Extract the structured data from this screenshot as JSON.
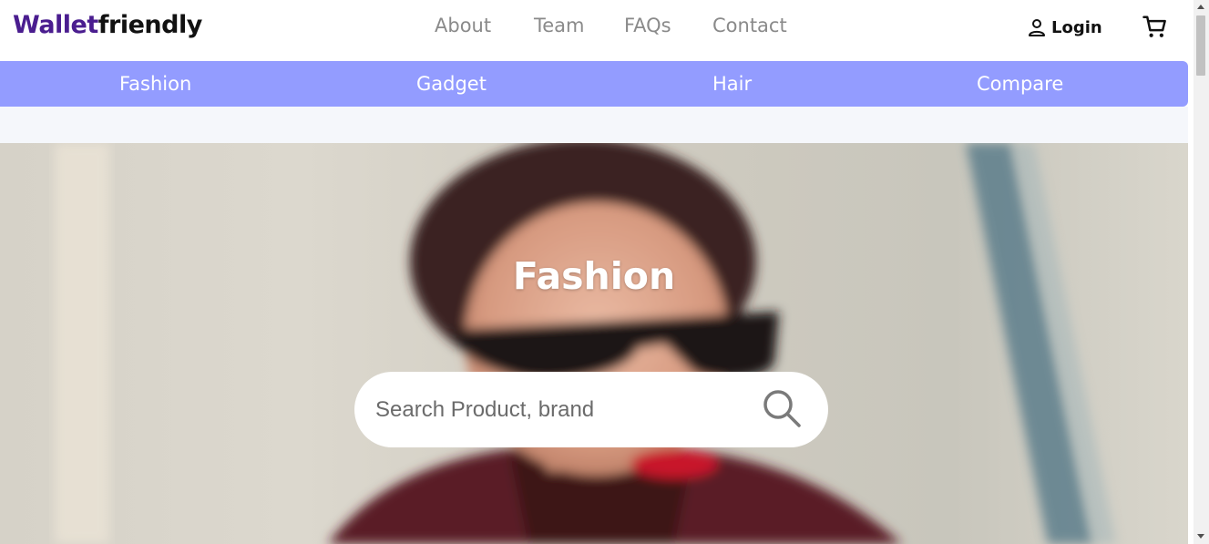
{
  "brand": {
    "part1": "Wallet",
    "part2": "friendly"
  },
  "top_nav": [
    {
      "label": "About"
    },
    {
      "label": "Team"
    },
    {
      "label": "FAQs"
    },
    {
      "label": "Contact"
    }
  ],
  "account": {
    "login_label": "Login"
  },
  "categories": [
    {
      "label": "Fashion"
    },
    {
      "label": "Gadget"
    },
    {
      "label": "Hair"
    },
    {
      "label": "Compare"
    }
  ],
  "hero": {
    "title": "Fashion",
    "search_placeholder": "Search Product, brand"
  },
  "colors": {
    "brand_purple": "#4a1d8f",
    "category_bar": "#939cff",
    "nav_text": "#8a8a8a"
  },
  "icons": {
    "login": "user-icon",
    "cart": "cart-icon",
    "search": "search-icon"
  }
}
